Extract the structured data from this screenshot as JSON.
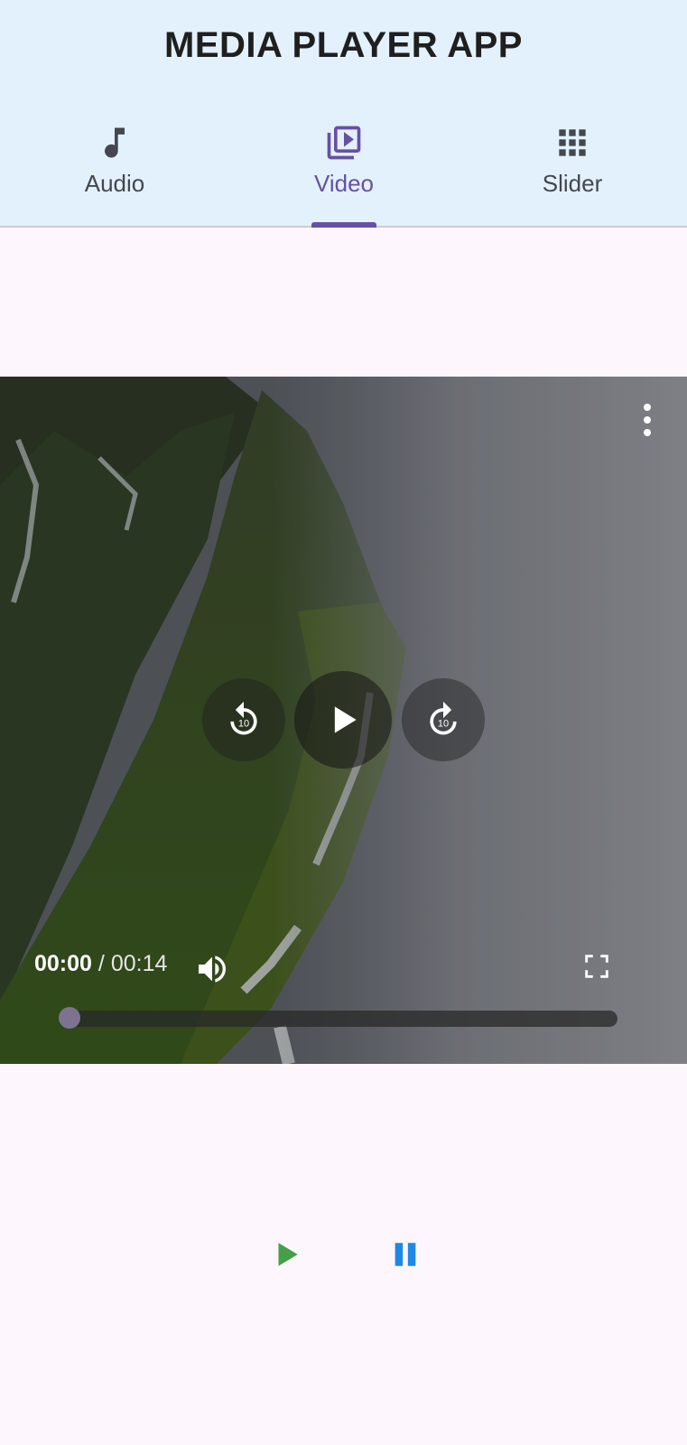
{
  "app": {
    "title": "MEDIA PLAYER APP"
  },
  "tabs": [
    {
      "label": "Audio",
      "icon": "music-note-icon",
      "active": false
    },
    {
      "label": "Video",
      "icon": "video-library-icon",
      "active": true
    },
    {
      "label": "Slider",
      "icon": "grid-icon",
      "active": false
    }
  ],
  "player": {
    "current_time": "00:00",
    "separator": "/",
    "duration": "00:14",
    "progress": 0.0,
    "rewind_seconds": "10",
    "forward_seconds": "10"
  },
  "colors": {
    "accent": "#6750a4",
    "appbar_bg": "#e3f1fc",
    "page_bg": "#fdf6fd",
    "play_green": "#43a047",
    "pause_blue": "#1e88e5"
  }
}
